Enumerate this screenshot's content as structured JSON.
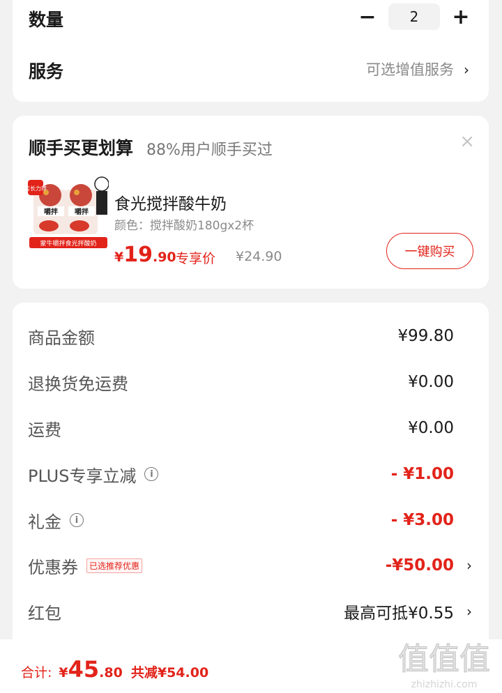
{
  "quantity": {
    "label": "数量",
    "value": "2",
    "minus": "−",
    "plus": "+"
  },
  "service": {
    "label": "服务",
    "value": "可选增值服务",
    "chevron": "›"
  },
  "bundle": {
    "title": "顺手买更划算",
    "subtitle": "88%用户顺手买过",
    "close": "×",
    "product": {
      "name": "食光搅拌酸牛奶",
      "spec": "颜色：搅拌酸奶180gx2杯",
      "price_yen": "¥",
      "price_int": "19",
      "price_dec": ".90",
      "price_tag": "专享价",
      "orig_price": "¥24.90",
      "image_badge": "店长力荐",
      "image_caption": "蒙牛嚼拌食光拌酸奶",
      "buy_label": "一键购买"
    }
  },
  "summary": {
    "rows": [
      {
        "label": "商品金额",
        "value": "¥99.80"
      },
      {
        "label": "退换货免运费",
        "value": "¥0.00"
      },
      {
        "label": "运费",
        "value": "¥0.00"
      },
      {
        "label": "PLUS专享立减",
        "value": "- ¥1.00",
        "info": "i"
      },
      {
        "label": "礼金",
        "value": "- ¥3.00",
        "info": "i"
      },
      {
        "label": "优惠券",
        "value": "-¥50.00",
        "tag": "已选推荐优惠",
        "chevron": "›"
      },
      {
        "label": "红包",
        "value": "最高可抵¥0.55",
        "chevron": "›"
      }
    ]
  },
  "footer": {
    "total_label": "合计:",
    "total_yen": "¥",
    "total_int": "45",
    "total_dec": ".80",
    "saved": "共减¥54.00"
  },
  "watermark": {
    "text": "zhizhizhi.com",
    "logo": "值值值"
  },
  "colors": {
    "accent": "#e2231a",
    "background": "#f2f2f2"
  }
}
